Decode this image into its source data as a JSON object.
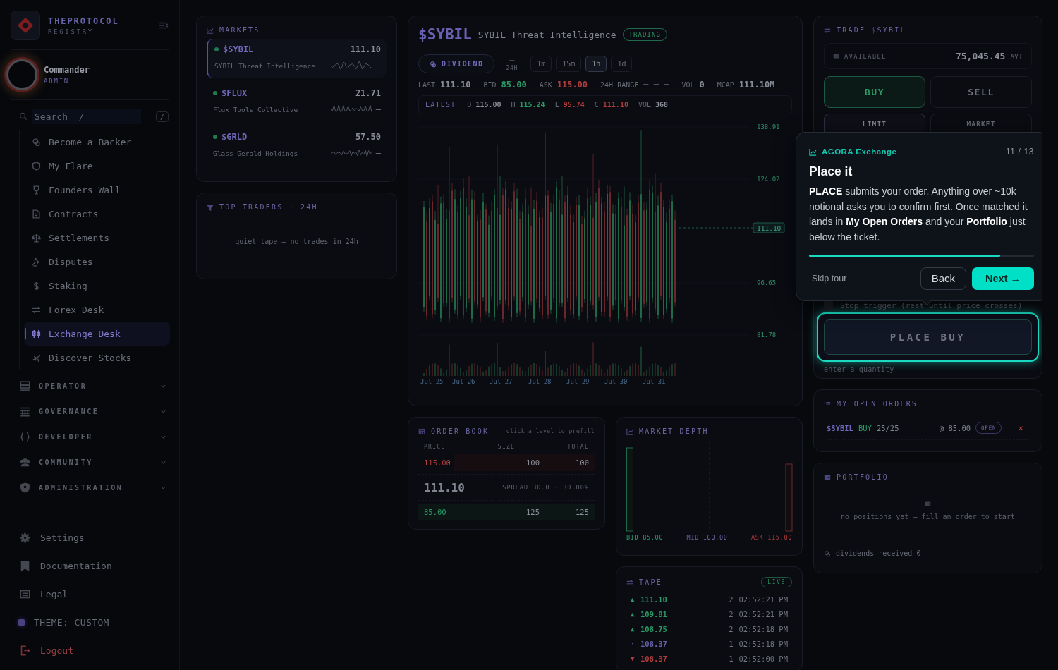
{
  "sidebar": {
    "brand": "THEPROTOCOL",
    "brand_sub": "REGISTRY",
    "user": {
      "name": "Commander",
      "role": "ADMIN"
    },
    "search": {
      "placeholder": "Search  /",
      "shortcut": "/"
    },
    "nav_items": [
      {
        "label": "Become a Backer",
        "selected": false
      },
      {
        "label": "My Flare",
        "selected": false
      },
      {
        "label": "Founders Wall",
        "selected": false
      },
      {
        "label": "Contracts",
        "selected": false
      },
      {
        "label": "Settlements",
        "selected": false
      },
      {
        "label": "Disputes",
        "selected": false
      },
      {
        "label": "Staking",
        "selected": false
      },
      {
        "label": "Forex Desk",
        "selected": false
      },
      {
        "label": "Exchange Desk",
        "selected": true
      },
      {
        "label": "Discover Stocks",
        "selected": false
      }
    ],
    "sections": [
      {
        "label": "OPERATOR",
        "expanded": false
      },
      {
        "label": "GOVERNANCE",
        "expanded": false
      },
      {
        "label": "DEVELOPER",
        "expanded": false
      },
      {
        "label": "COMMUNITY",
        "expanded": false
      },
      {
        "label": "ADMINISTRATION",
        "expanded": false
      }
    ],
    "footer_items": [
      {
        "label": "Settings",
        "kind": "link"
      },
      {
        "label": "Documentation",
        "kind": "link"
      },
      {
        "label": "Legal",
        "kind": "link"
      },
      {
        "label": "THEME: CUSTOM",
        "kind": "theme"
      },
      {
        "label": "Logout",
        "kind": "logout"
      }
    ]
  },
  "markets": {
    "title": "MARKETS",
    "items": [
      {
        "ticker": "$SYBIL",
        "price": "111.10",
        "name": "SYBIL Threat Intelligence",
        "change": "–",
        "color": "#1f7a52",
        "selected": true
      },
      {
        "ticker": "$FLUX",
        "price": "21.71",
        "name": "Flux Tools Collective",
        "change": "–",
        "color": "#1f7a52",
        "selected": false
      },
      {
        "ticker": "$GRLD",
        "price": "57.50",
        "name": "Glass Gerald Holdings",
        "change": "–",
        "color": "#1f7a52",
        "selected": false
      }
    ]
  },
  "top_traders": {
    "title": "TOP TRADERS · 24H",
    "empty": "quiet tape — no trades in 24h"
  },
  "instrument": {
    "ticker": "$SYBIL",
    "name": "SYBIL Threat Intelligence",
    "status": "TRADING",
    "dividend": "DIVIDEND",
    "change": "—",
    "change_label": "24H",
    "timeframes": [
      {
        "label": "1m",
        "selected": false
      },
      {
        "label": "15m",
        "selected": false
      },
      {
        "label": "1h",
        "selected": true
      },
      {
        "label": "1d",
        "selected": false
      }
    ],
    "stats": [
      {
        "label": "LAST",
        "value": "111.10",
        "color": "#8a8e98"
      },
      {
        "label": "BID",
        "value": "85.00",
        "color": "#2a9a66"
      },
      {
        "label": "ASK",
        "value": "115.00",
        "color": "#b03c3c"
      },
      {
        "label": "24H RANGE",
        "value": "— — —",
        "color": "#8a8e98"
      },
      {
        "label": "VOL",
        "value": "0",
        "color": "#8a8e98"
      },
      {
        "label": "MCAP",
        "value": "111.10M",
        "color": "#8a8e98"
      }
    ],
    "latest": {
      "label": "LATEST",
      "fields": [
        {
          "label": "O",
          "value": "115.00",
          "color": "#8a8e98"
        },
        {
          "label": "H",
          "value": "115.24",
          "color": "#2a9a66"
        },
        {
          "label": "L",
          "value": "95.74",
          "color": "#b03c3c"
        },
        {
          "label": "C",
          "value": "111.10",
          "color": "#b03c3c"
        },
        {
          "label": "VOL",
          "value": "368",
          "color": "#8a8e98"
        }
      ]
    },
    "chart": {
      "y_labels": [
        "138.91",
        "124.02",
        "96.65",
        "81.78"
      ],
      "price_tag": "111.10",
      "x_labels": [
        "Jul 25",
        "Jul 26",
        "Jul 27",
        "Jul 28",
        "Jul 29",
        "Jul 30",
        "Jul 31"
      ]
    }
  },
  "order_book": {
    "title": "ORDER BOOK",
    "hint": "click a level to prefill",
    "columns": [
      "PRICE",
      "SIZE",
      "TOTAL"
    ],
    "asks": [
      {
        "price": "115.00",
        "size": "100",
        "total": "100",
        "level": 0.8
      }
    ],
    "last": "111.10",
    "spread": "SPREAD 30.0 · 30.00%",
    "bids": [
      {
        "price": "85.00",
        "size": "125",
        "total": "125",
        "level": 1
      }
    ]
  },
  "market_depth": {
    "title": "MARKET DEPTH",
    "bid": "BID 85.00",
    "mid": "MID 100.00",
    "ask": "ASK 115.00"
  },
  "tape": {
    "title": "TAPE",
    "badge": "LIVE",
    "trades": [
      {
        "color": "#2a9a66",
        "arrow": "▲",
        "price": "111.10",
        "size": "2",
        "time": "02:52:21 PM"
      },
      {
        "color": "#2a9a66",
        "arrow": "▲",
        "price": "109.81",
        "size": "2",
        "time": "02:52:21 PM"
      },
      {
        "color": "#2a9a66",
        "arrow": "▲",
        "price": "108.75",
        "size": "2",
        "time": "02:52:18 PM"
      },
      {
        "color": "#6a62a8",
        "arrow": "·",
        "price": "108.37",
        "size": "1",
        "time": "02:52:18 PM"
      },
      {
        "color": "#b03c3c",
        "arrow": "▼",
        "price": "108.37",
        "size": "1",
        "time": "02:52:00 PM"
      }
    ]
  },
  "trade": {
    "title": "TRADE $SYBIL",
    "available_label": "AVAILABLE",
    "available": "75,045.45",
    "currency": "AVT",
    "sides": [
      {
        "label": "BUY",
        "selected": true
      },
      {
        "label": "SELL",
        "selected": false
      }
    ],
    "order_types": [
      {
        "label": "LIMIT",
        "selected": true
      },
      {
        "label": "MARKET",
        "selected": false
      }
    ],
    "stop": {
      "label": "Stop trigger (rest until price crosses)",
      "checked": false
    },
    "submit": "PLACE BUY",
    "hint": "enter a quantity"
  },
  "open_orders": {
    "title": "MY OPEN ORDERS",
    "orders": [
      {
        "ticker": "$SYBIL",
        "side": "BUY",
        "filled": "25/25",
        "price": "@ 85.00",
        "status": "OPEN",
        "cancel": "×"
      }
    ]
  },
  "portfolio": {
    "title": "PORTFOLIO",
    "empty": "no positions yet — fill an order to start",
    "dividends": "dividends received 0"
  },
  "tour": {
    "product": "AGORA Exchange",
    "step": "11 / 13",
    "title": "Place it",
    "body": "**PLACE** submits your order. Anything over ~10k notional asks you to confirm first. Once matched it lands in **My Open Orders** and your **Portfolio** just below the ticket.",
    "level": 0.85,
    "skip": "Skip tour",
    "back": "Back",
    "next": "Next →"
  }
}
